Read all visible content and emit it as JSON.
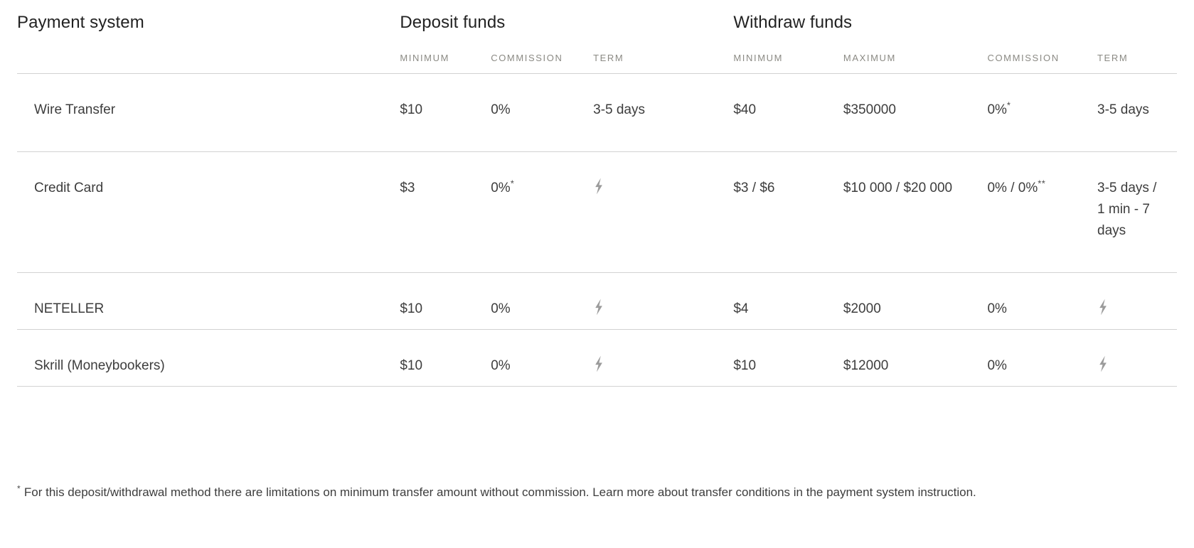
{
  "table": {
    "groups": {
      "payment_system": "Payment system",
      "deposit_funds": "Deposit funds",
      "withdraw_funds": "Withdraw funds"
    },
    "subheaders": {
      "deposit_minimum": "MINIMUM",
      "deposit_commission": "COMMISSION",
      "deposit_term": "TERM",
      "withdraw_minimum": "MINIMUM",
      "withdraw_maximum": "MAXIMUM",
      "withdraw_commission": "COMMISSION",
      "withdraw_term": "TERM"
    },
    "rows": [
      {
        "system": "Wire Transfer",
        "deposit_minimum": "$10",
        "deposit_commission": "0%",
        "deposit_commission_mark": "",
        "deposit_term": "3-5 days",
        "deposit_term_icon": "",
        "withdraw_minimum": "$40",
        "withdraw_maximum": "$350000",
        "withdraw_commission": "0%",
        "withdraw_commission_mark": "*",
        "withdraw_term": "3-5 days",
        "withdraw_term_icon": ""
      },
      {
        "system": "Credit Card",
        "deposit_minimum": "$3",
        "deposit_commission": "0%",
        "deposit_commission_mark": "*",
        "deposit_term": "",
        "deposit_term_icon": "lightning-bolt-icon",
        "withdraw_minimum": "$3 / $6",
        "withdraw_maximum": "$10 000 / $20 000",
        "withdraw_commission": "0% / 0%",
        "withdraw_commission_mark": "**",
        "withdraw_term": "3-5 days / 1 min - 7 days",
        "withdraw_term_icon": ""
      },
      {
        "system": "NETELLER",
        "deposit_minimum": "$10",
        "deposit_commission": "0%",
        "deposit_commission_mark": "",
        "deposit_term": "",
        "deposit_term_icon": "lightning-bolt-icon",
        "withdraw_minimum": "$4",
        "withdraw_maximum": "$2000",
        "withdraw_commission": "0%",
        "withdraw_commission_mark": "",
        "withdraw_term": "",
        "withdraw_term_icon": "lightning-bolt-icon"
      },
      {
        "system": "Skrill (Moneybookers)",
        "deposit_minimum": "$10",
        "deposit_commission": "0%",
        "deposit_commission_mark": "",
        "deposit_term": "",
        "deposit_term_icon": "lightning-bolt-icon",
        "withdraw_minimum": "$10",
        "withdraw_maximum": "$12000",
        "withdraw_commission": "0%",
        "withdraw_commission_mark": "",
        "withdraw_term": "",
        "withdraw_term_icon": "lightning-bolt-icon"
      }
    ]
  },
  "footnote": {
    "mark": "*",
    "text": "For this deposit/withdrawal method there are limitations on minimum transfer amount without commission. Learn more about transfer conditions in the payment system instruction."
  },
  "colors": {
    "page_background": "#ffffff",
    "group_header_text": "#222222",
    "subheader_text": "#8b8a84",
    "body_text": "#3d3d3d",
    "rule": "#d2d2d2",
    "bolt_icon": "#9b9b9b"
  }
}
